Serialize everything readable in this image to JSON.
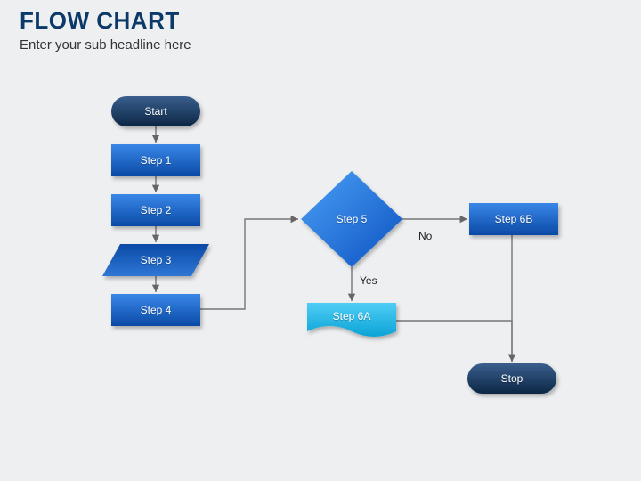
{
  "title": "FLOW CHART",
  "subtitle": "Enter your sub headline here",
  "nodes": {
    "start": {
      "label": "Start"
    },
    "step1": {
      "label": "Step 1"
    },
    "step2": {
      "label": "Step 2"
    },
    "step3": {
      "label": "Step 3"
    },
    "step4": {
      "label": "Step 4"
    },
    "step5": {
      "label": "Step 5"
    },
    "step6a": {
      "label": "Step 6A"
    },
    "step6b": {
      "label": "Step 6B"
    },
    "stop": {
      "label": "Stop"
    }
  },
  "edges": {
    "step5_no": {
      "label": "No"
    },
    "step5_yes": {
      "label": "Yes"
    }
  }
}
